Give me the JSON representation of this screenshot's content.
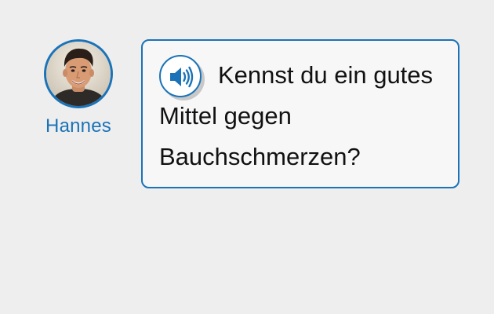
{
  "speaker": {
    "name": "Hannes",
    "avatar_icon": "person-photo-avatar"
  },
  "message": {
    "audio_icon": "speaker-volume-icon",
    "lines": [
      "Kennst du ein gutes",
      "Mittel gegen",
      "Bauchschmerzen?"
    ]
  },
  "colors": {
    "accent": "#1a73b8",
    "background": "#eeeeee",
    "bubble_background": "#f7f7f7",
    "text": "#111111"
  }
}
